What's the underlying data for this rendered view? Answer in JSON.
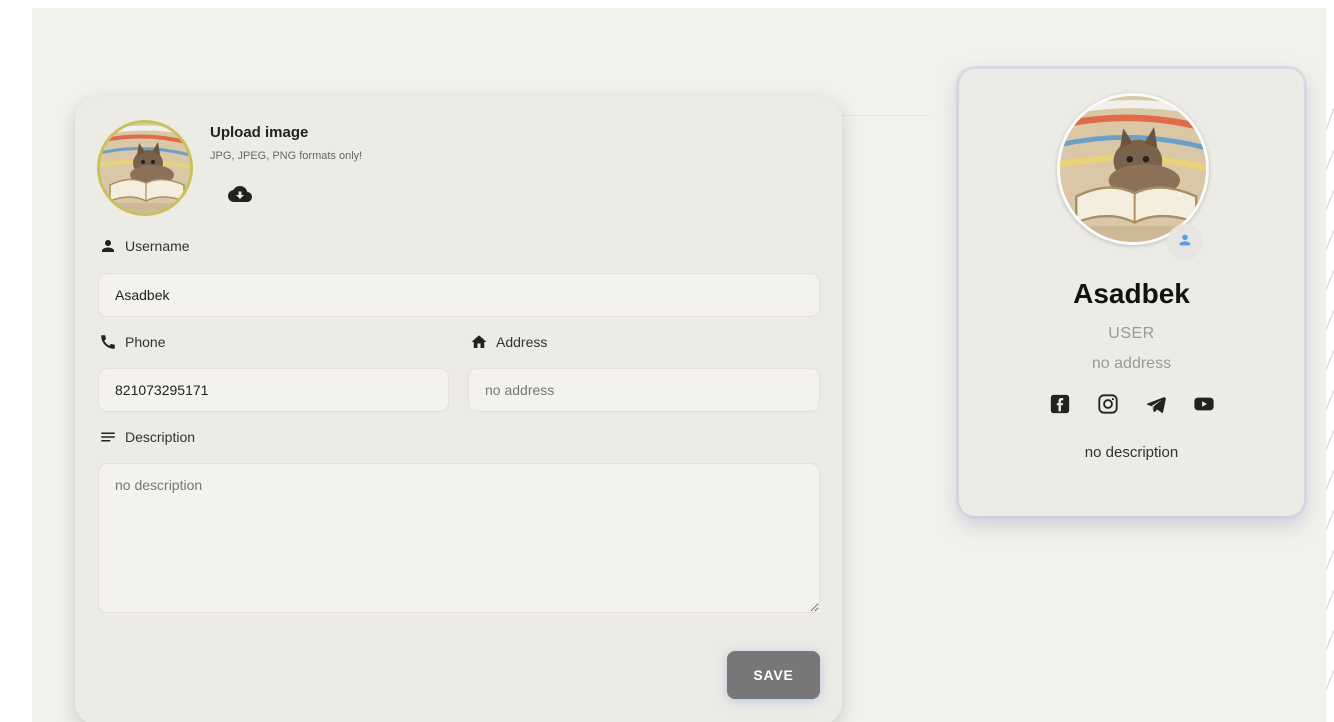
{
  "upload": {
    "title": "Upload image",
    "hint": "JPG, JPEG, PNG formats only!",
    "icon": "cloud-download-icon"
  },
  "form": {
    "username": {
      "label": "Username",
      "value": "Asadbek",
      "icon": "person-icon"
    },
    "phone": {
      "label": "Phone",
      "value": "821073295171",
      "icon": "phone-icon"
    },
    "address": {
      "label": "Address",
      "value": "",
      "placeholder": "no address",
      "icon": "home-icon"
    },
    "description": {
      "label": "Description",
      "value": "",
      "placeholder": "no description",
      "icon": "notes-icon"
    },
    "save_label": "SAVE"
  },
  "profile": {
    "name": "Asadbek",
    "role": "USER",
    "address": "no address",
    "description": "no description",
    "socials": [
      "facebook-icon",
      "instagram-icon",
      "telegram-icon",
      "youtube-icon"
    ]
  },
  "colors": {
    "background": "#f2f1ec",
    "card": "#ecebe5",
    "save_button": "#777777",
    "avatar_ring": "#c9c25a",
    "badge_icon": "#5b9bf0"
  }
}
